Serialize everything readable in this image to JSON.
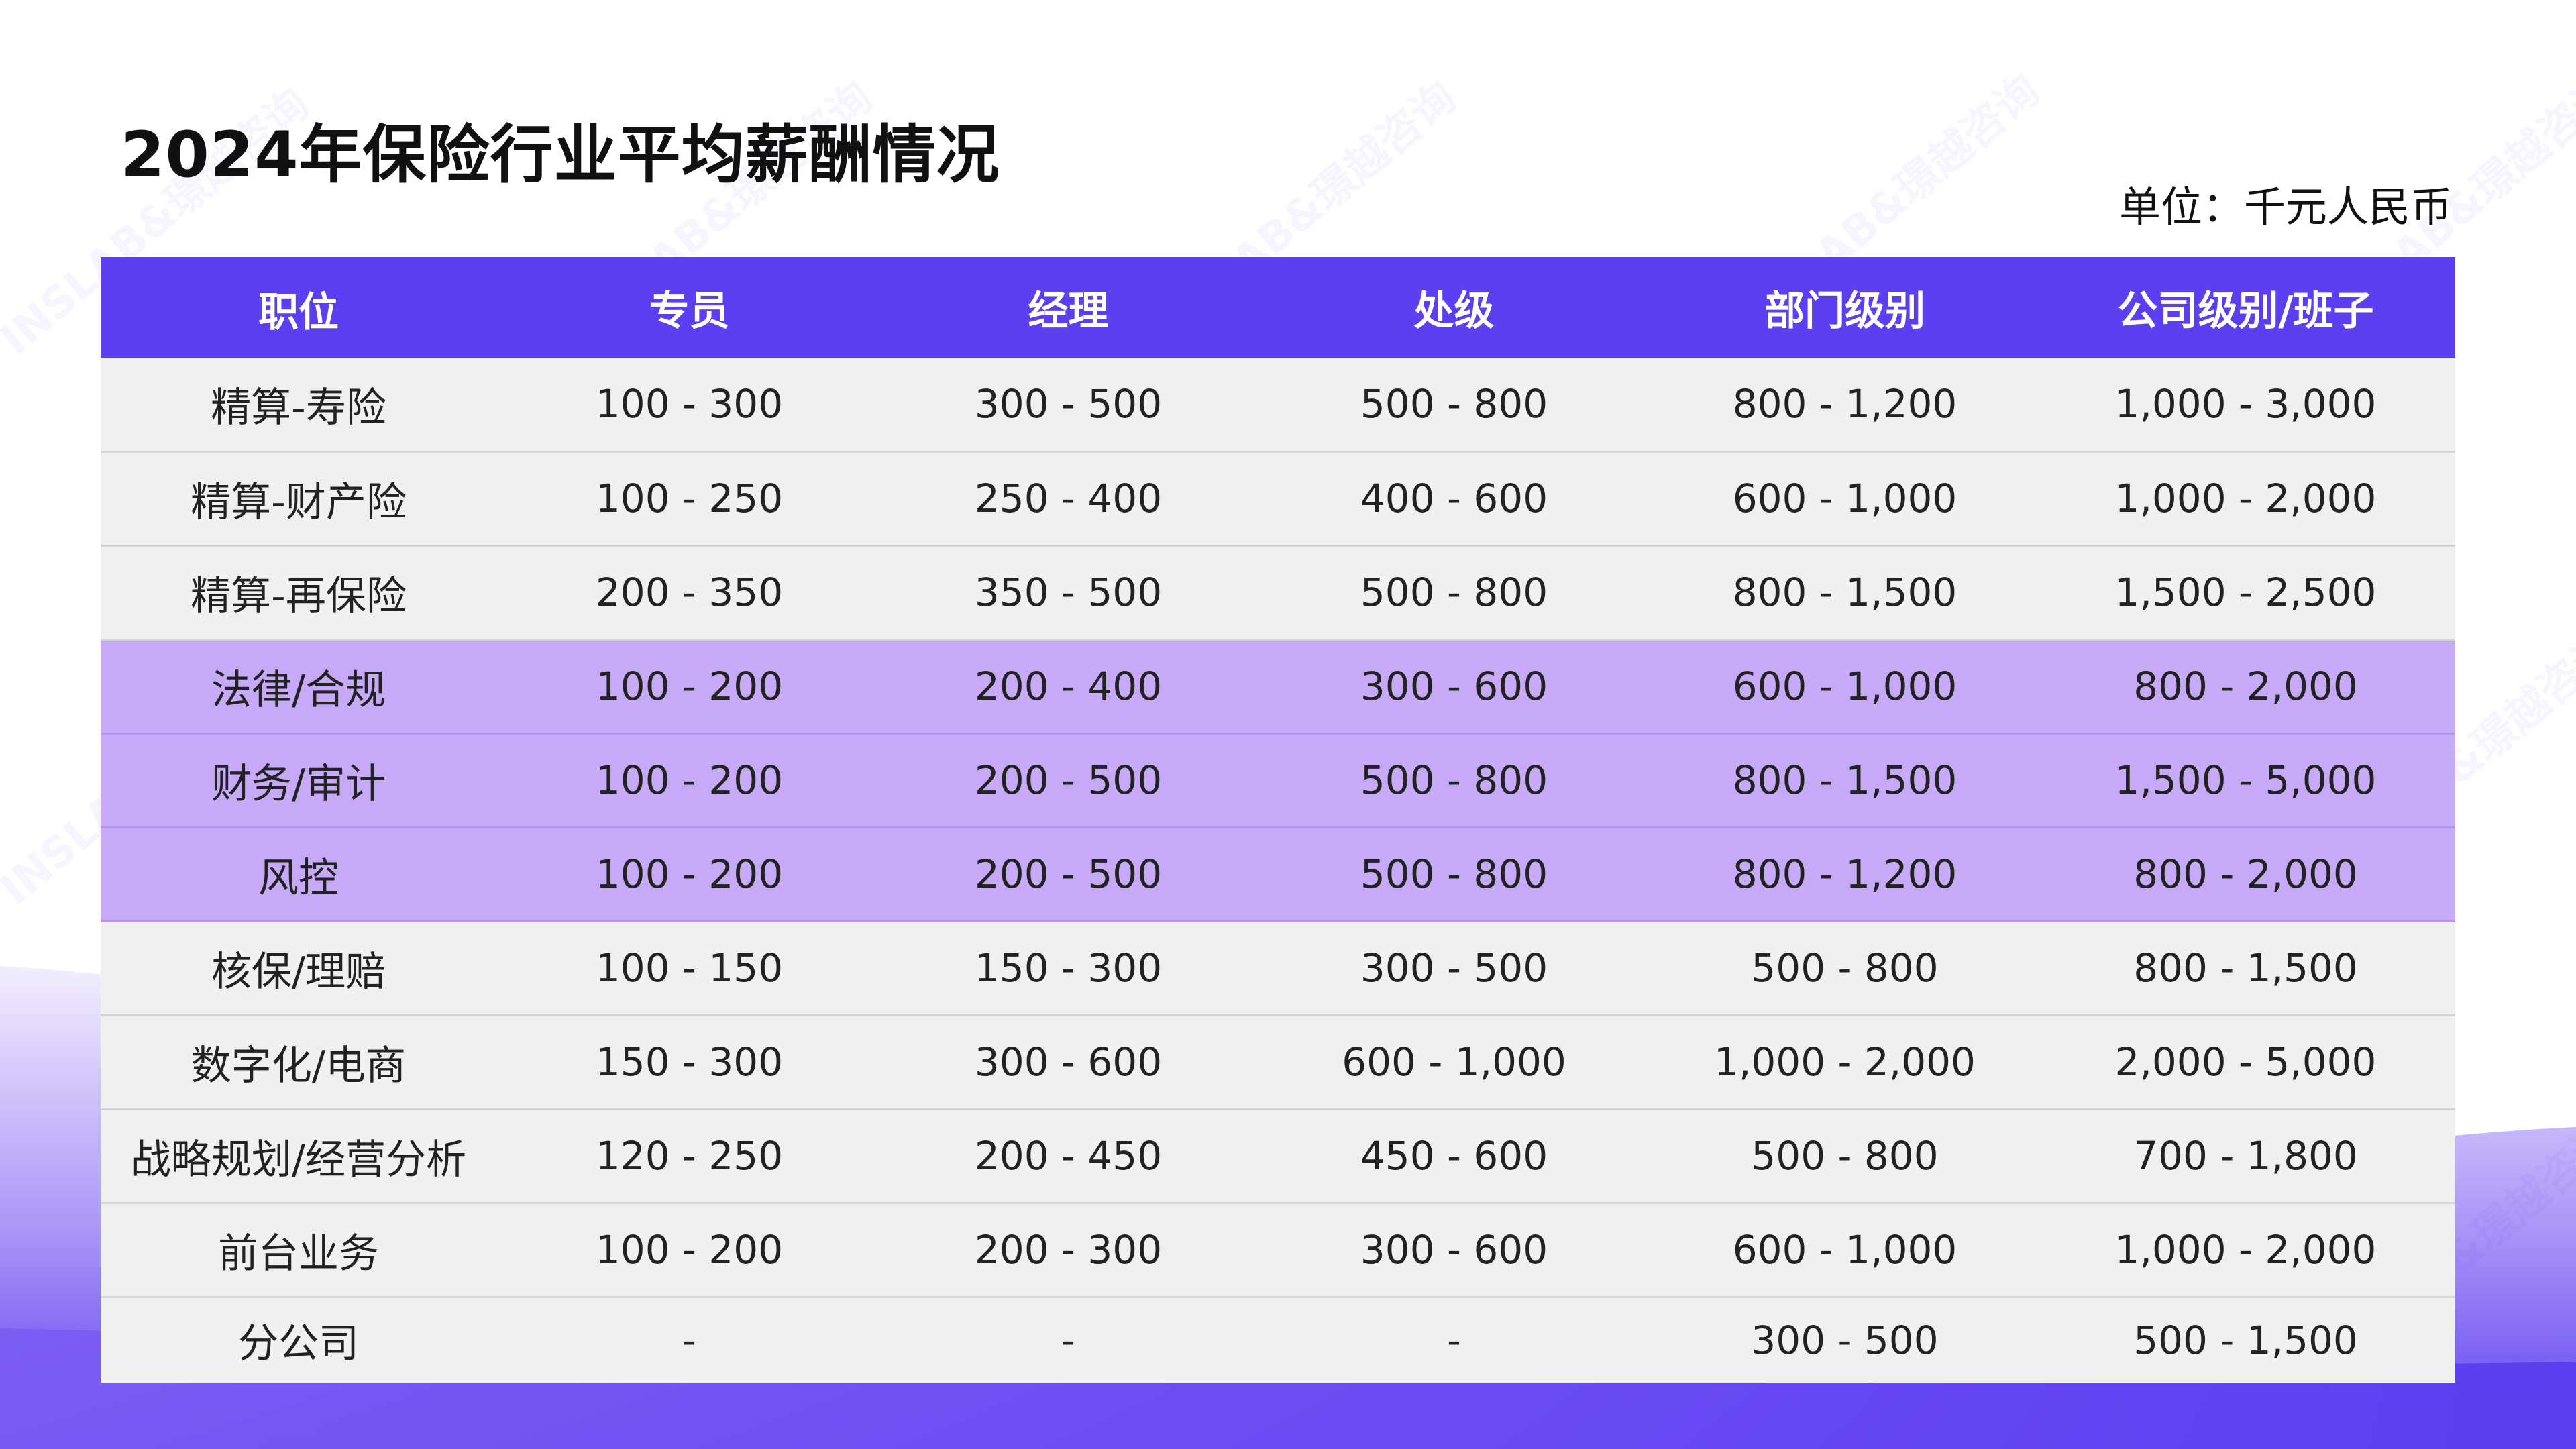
{
  "title": "2024年保险行业平均薪酬情况",
  "unit": "单位：千元人民币",
  "watermark": "INSLAB&璟越咨询",
  "colors": {
    "header_bg": "#5b3ff0",
    "row_bg": "#f0f0f0",
    "highlight_row_bg": "#c6a9f7",
    "wave_purple": "#6a4af2"
  },
  "table": {
    "columns": [
      "职位",
      "专员",
      "经理",
      "处级",
      "部门级别",
      "公司级别/班子"
    ],
    "rows": [
      {
        "highlight": false,
        "cells": [
          "精算-寿险",
          "100 - 300",
          "300 - 500",
          "500 - 800",
          "800 - 1,200",
          "1,000 - 3,000"
        ]
      },
      {
        "highlight": false,
        "cells": [
          "精算-财产险",
          "100 - 250",
          "250 - 400",
          "400 - 600",
          "600 - 1,000",
          "1,000 - 2,000"
        ]
      },
      {
        "highlight": false,
        "cells": [
          "精算-再保险",
          "200 - 350",
          "350 - 500",
          "500 - 800",
          "800 - 1,500",
          "1,500 - 2,500"
        ]
      },
      {
        "highlight": true,
        "cells": [
          "法律/合规",
          "100 - 200",
          "200 - 400",
          "300 - 600",
          "600 - 1,000",
          "800 - 2,000"
        ]
      },
      {
        "highlight": true,
        "cells": [
          "财务/审计",
          "100 - 200",
          "200 - 500",
          "500 - 800",
          "800 - 1,500",
          "1,500 - 5,000"
        ]
      },
      {
        "highlight": true,
        "cells": [
          "风控",
          "100 - 200",
          "200 - 500",
          "500 - 800",
          "800 - 1,200",
          "800 - 2,000"
        ]
      },
      {
        "highlight": false,
        "cells": [
          "核保/理赔",
          "100 - 150",
          "150 - 300",
          "300 - 500",
          "500 - 800",
          "800 - 1,500"
        ]
      },
      {
        "highlight": false,
        "cells": [
          "数字化/电商",
          "150 - 300",
          "300 - 600",
          "600 - 1,000",
          "1,000 - 2,000",
          "2,000 - 5,000"
        ]
      },
      {
        "highlight": false,
        "cells": [
          "战略规划/经营分析",
          "120 - 250",
          "200 - 450",
          "450 - 600",
          "500 - 800",
          "700 - 1,800"
        ]
      },
      {
        "highlight": false,
        "cells": [
          "前台业务",
          "100 - 200",
          "200 - 300",
          "300 - 600",
          "600 - 1,000",
          "1,000 - 2,000"
        ]
      },
      {
        "highlight": false,
        "cells": [
          "分公司",
          "-",
          "-",
          "-",
          "300 - 500",
          "500 - 1,500"
        ]
      }
    ]
  }
}
